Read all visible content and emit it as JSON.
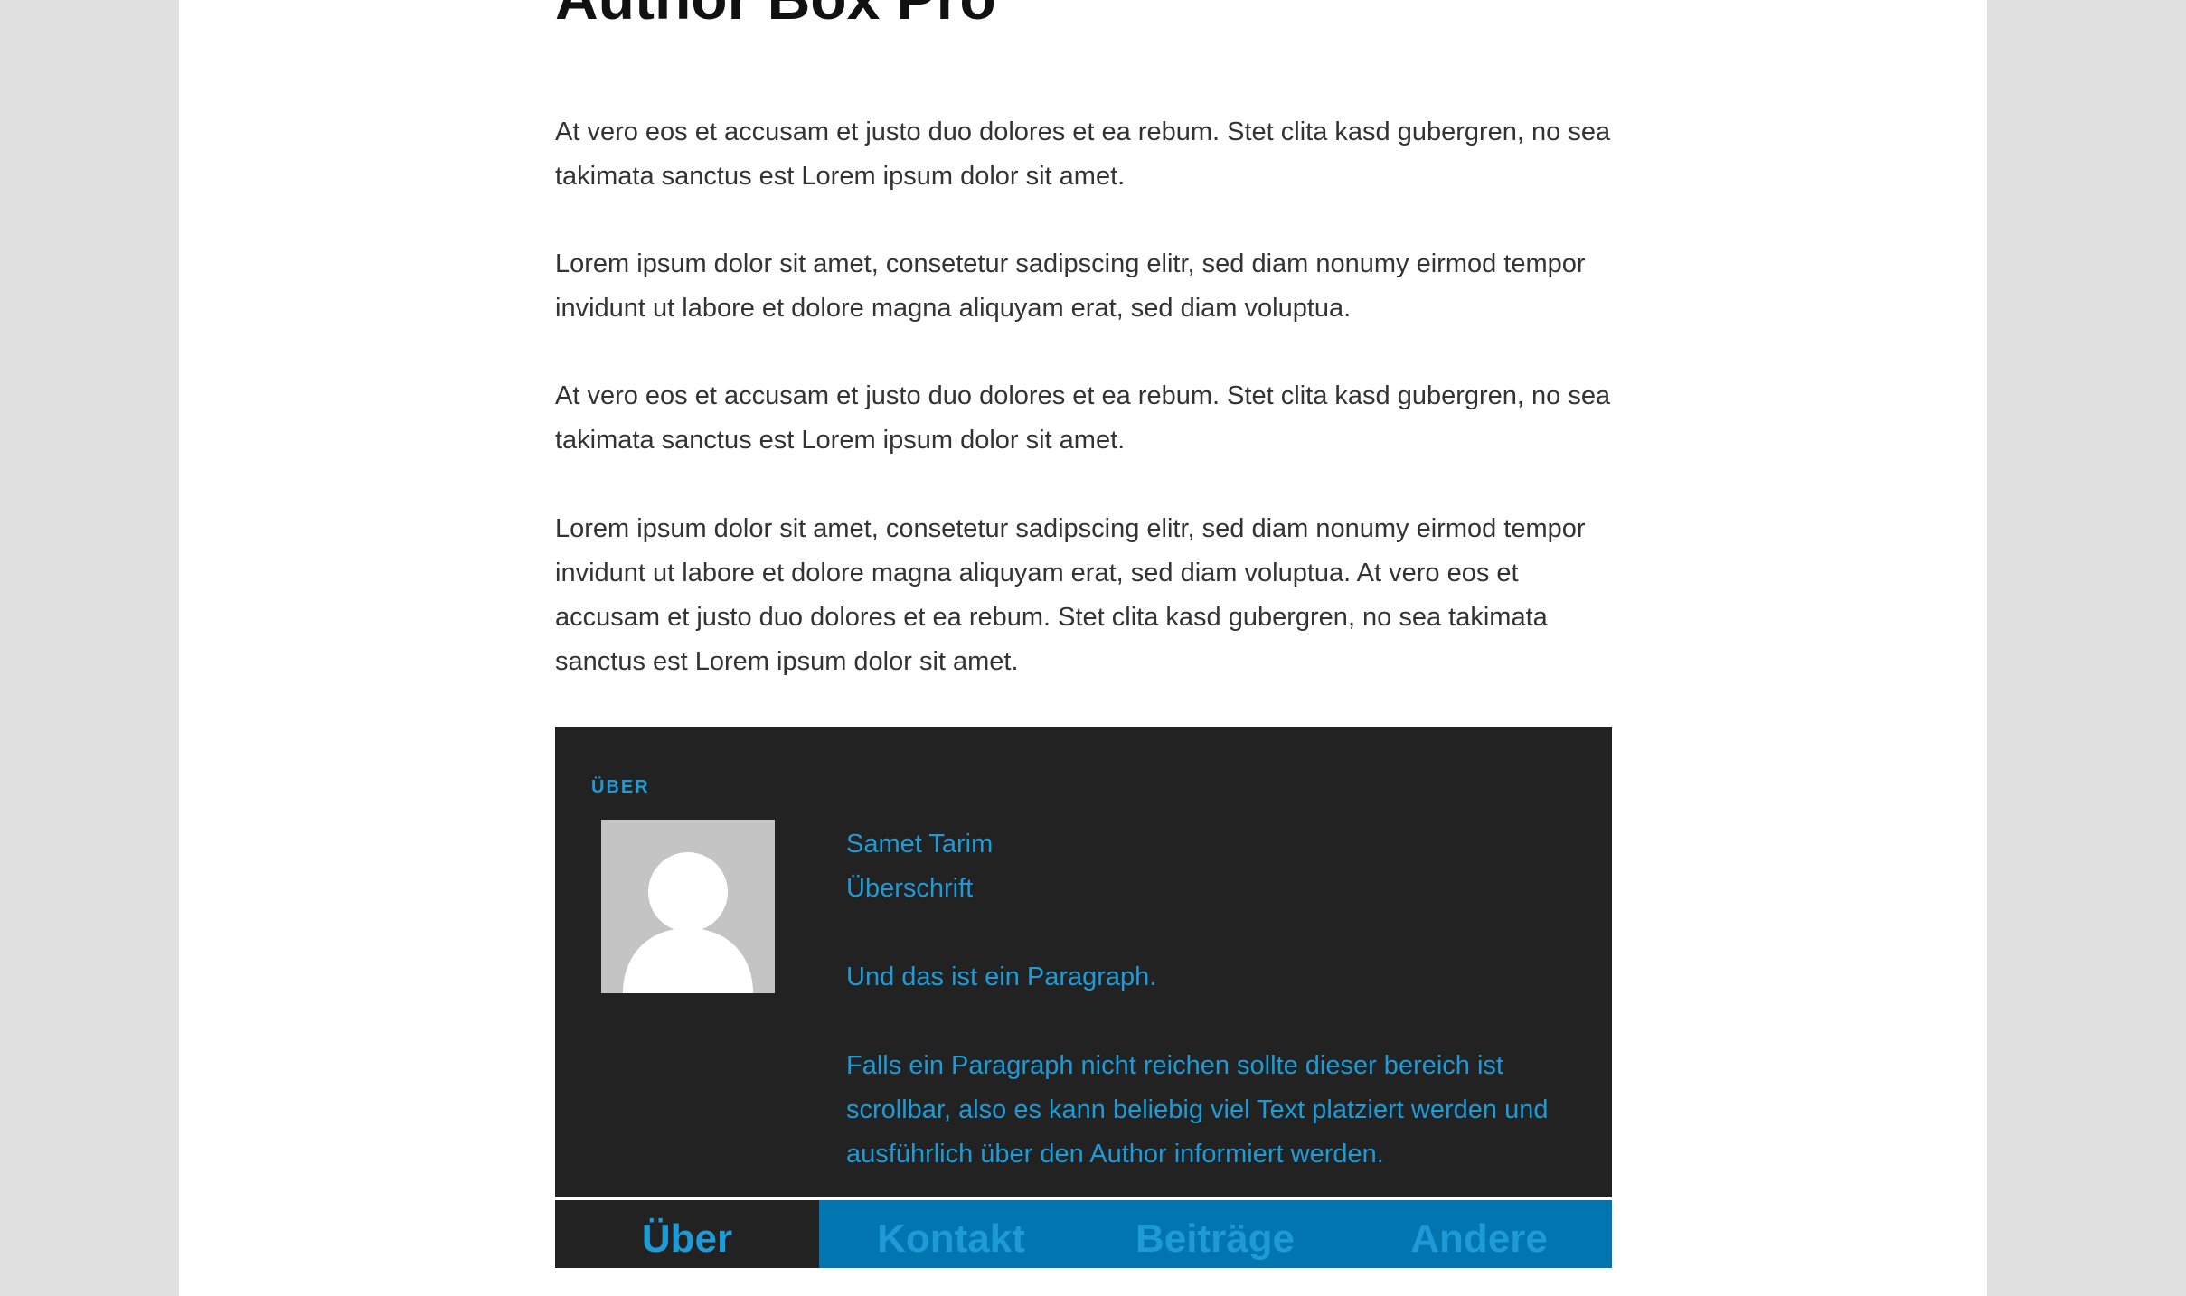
{
  "article": {
    "title": "Author Box Pro",
    "paragraphs": [
      "At vero eos et accusam et justo duo dolores et ea rebum. Stet clita kasd gubergren, no sea takimata sanctus est Lorem ipsum dolor sit amet.",
      "Lorem ipsum dolor sit amet, consetetur sadipscing elitr, sed diam nonumy eirmod tempor invidunt ut labore et dolore magna aliquyam erat, sed diam voluptua.",
      "At vero eos et accusam et justo duo dolores et ea rebum. Stet clita kasd gubergren, no sea takimata sanctus est Lorem ipsum dolor sit amet.",
      "Lorem ipsum dolor sit amet, consetetur sadipscing elitr, sed diam nonumy eirmod tempor invidunt ut labore et dolore magna aliquyam erat, sed diam voluptua. At vero eos et accusam et justo duo dolores et ea rebum. Stet clita kasd gubergren, no sea takimata sanctus est Lorem ipsum dolor sit amet."
    ]
  },
  "author_box": {
    "heading": "ÜBER",
    "avatar_icon": "default-user-avatar-icon",
    "name": "Samet Tarim",
    "subtitle": "Überschrift",
    "paragraph1": "Und das ist ein Paragraph.",
    "paragraph2": "Falls ein Paragraph nicht reichen sollte dieser bereich ist scrollbar, also es kann beliebig viel Text platziert werden und ausführlich über den Author informiert werden.",
    "tabs": [
      {
        "label": "Über",
        "active": true
      },
      {
        "label": "Kontakt",
        "active": false
      },
      {
        "label": "Beiträge",
        "active": false
      },
      {
        "label": "Andere",
        "active": false
      }
    ]
  },
  "colors": {
    "page_background": "#e1e1e1",
    "content_background": "#ffffff",
    "box_background": "#222222",
    "accent": "#1e9ad6",
    "tabbar_background": "#0075b0"
  }
}
